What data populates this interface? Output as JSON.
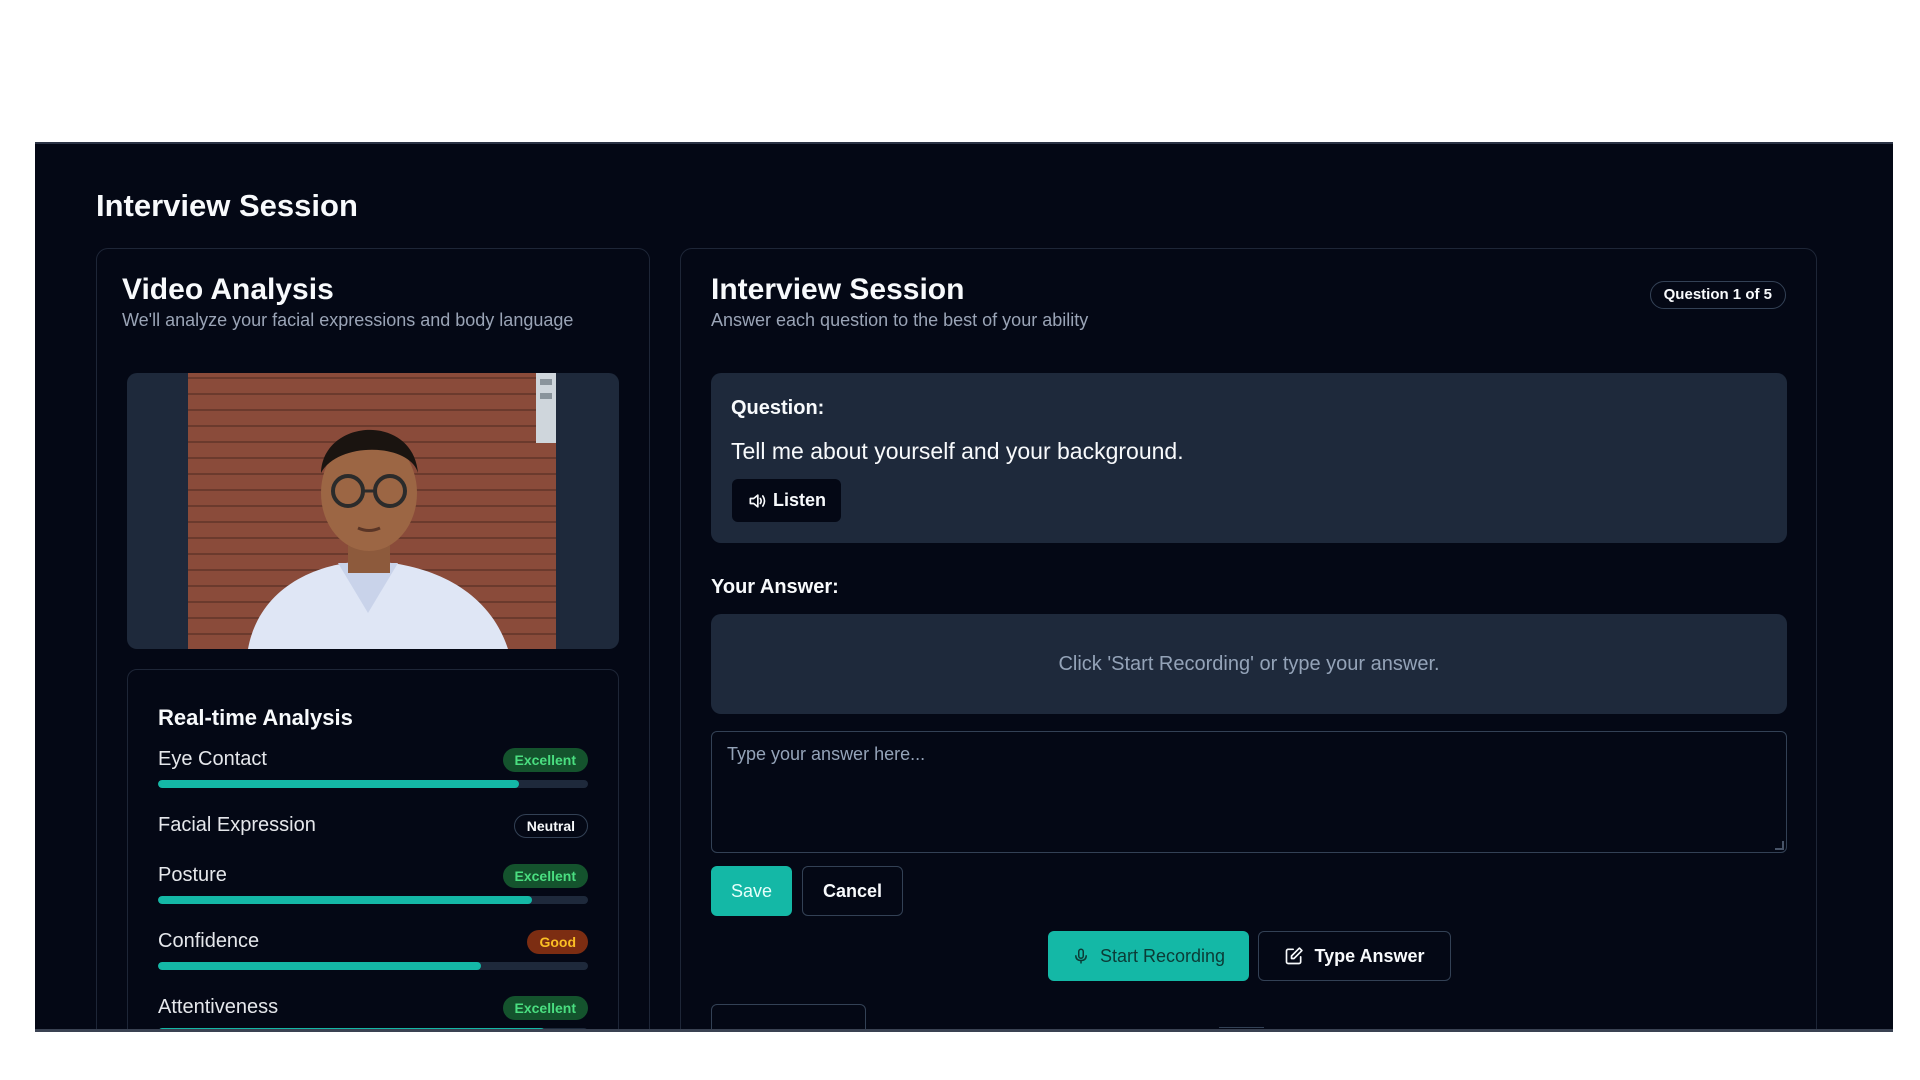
{
  "page": {
    "title": "Interview Session"
  },
  "video_card": {
    "title": "Video Analysis",
    "subtitle": "We'll analyze your facial expressions and body language"
  },
  "analysis": {
    "title": "Real-time Analysis",
    "metrics": [
      {
        "label": "Eye Contact",
        "badge": "Excellent",
        "level": 0.84,
        "status": "excellent"
      },
      {
        "label": "Facial Expression",
        "badge": "Neutral",
        "status": "neutral"
      },
      {
        "label": "Posture",
        "badge": "Excellent",
        "level": 0.87,
        "status": "excellent"
      },
      {
        "label": "Confidence",
        "badge": "Good",
        "level": 0.75,
        "status": "good"
      },
      {
        "label": "Attentiveness",
        "badge": "Excellent",
        "level": 0.9,
        "status": "excellent"
      }
    ]
  },
  "session": {
    "title": "Interview Session",
    "subtitle": "Answer each question to the best of your ability",
    "progress_badge": "Question 1 of 5",
    "question_label": "Question:",
    "question_text": "Tell me about yourself and your background.",
    "listen_label": "Listen",
    "answer_label": "Your Answer:",
    "answer_placeholder_display": "Click 'Start Recording' or type your answer.",
    "input_placeholder": "Type your answer here...",
    "save_label": "Save",
    "cancel_label": "Cancel",
    "record_label": "Start Recording",
    "type_label": "Type Answer"
  },
  "colors": {
    "accent": "#14b8a6",
    "background": "#040815",
    "panel": "#1e293b",
    "excellent": "#4ade80",
    "good": "#fbbf24"
  }
}
